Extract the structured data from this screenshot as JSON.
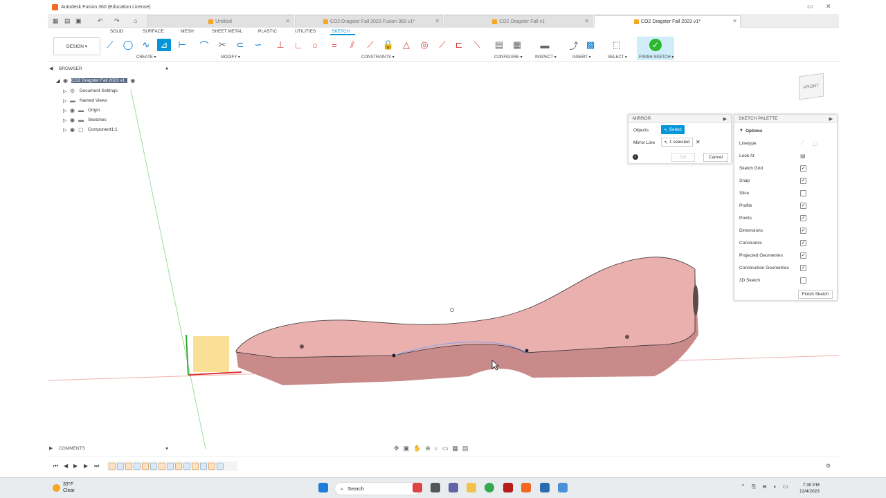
{
  "app": {
    "title": "Autodesk Fusion 360 (Education License)"
  },
  "doc_tabs": [
    {
      "label": "Untitled"
    },
    {
      "label": "CO2 Dragster Fall 2023 Fusion 360 v1*"
    },
    {
      "label": "CO2 Dragster Fall v1"
    },
    {
      "label": "CO2 Dragster Fall 2023 v1*"
    }
  ],
  "ribbon_tabs": [
    "SOLID",
    "SURFACE",
    "MESH",
    "SHEET METAL",
    "PLASTIC",
    "UTILITIES",
    "SKETCH"
  ],
  "workspace": {
    "label": "DESIGN ▾"
  },
  "tool_groups": {
    "create": "CREATE ▾",
    "modify": "MODIFY ▾",
    "constraints": "CONSTRAINTS ▾",
    "configure": "CONFIGURE ▾",
    "inspect": "INSPECT ▾",
    "insert": "INSERT ▾",
    "select": "SELECT ▾",
    "finish": "FINISH SKETCH ▾"
  },
  "browser": {
    "title": "BROWSER",
    "root": "CO2 Dragster Fall 2023 v1",
    "items": [
      "Document Settings",
      "Named Views",
      "Origin",
      "Sketches",
      "Component1:1"
    ]
  },
  "mirror": {
    "title": "MIRROR",
    "objects_label": "Objects",
    "select_label": "Select",
    "mirror_line_label": "Mirror Line",
    "selected_label": "1 selected",
    "ok": "OK",
    "cancel": "Cancel"
  },
  "palette": {
    "title": "SKETCH PALETTE",
    "options_label": "Options",
    "linetype": "Linetype",
    "look_at": "Look At",
    "items": [
      {
        "label": "Sketch Grid",
        "checked": true
      },
      {
        "label": "Snap",
        "checked": true
      },
      {
        "label": "Slice",
        "checked": false
      },
      {
        "label": "Profile",
        "checked": true
      },
      {
        "label": "Points",
        "checked": true
      },
      {
        "label": "Dimensions",
        "checked": true
      },
      {
        "label": "Constraints",
        "checked": true
      },
      {
        "label": "Projected Geometries",
        "checked": true
      },
      {
        "label": "Construction Geometries",
        "checked": true
      },
      {
        "label": "3D Sketch",
        "checked": false
      }
    ],
    "finish": "Finish Sketch"
  },
  "viewcube": {
    "face": "FRONT"
  },
  "comments": {
    "label": "COMMENTS"
  },
  "taskbar": {
    "temp": "33°F",
    "weather": "Clear",
    "search": "Search",
    "time": "7:30 PM",
    "date": "12/4/2023"
  },
  "colors": {
    "accent": "#0696d7",
    "body": "#e8a0a0",
    "finish": "#2eb82e"
  }
}
